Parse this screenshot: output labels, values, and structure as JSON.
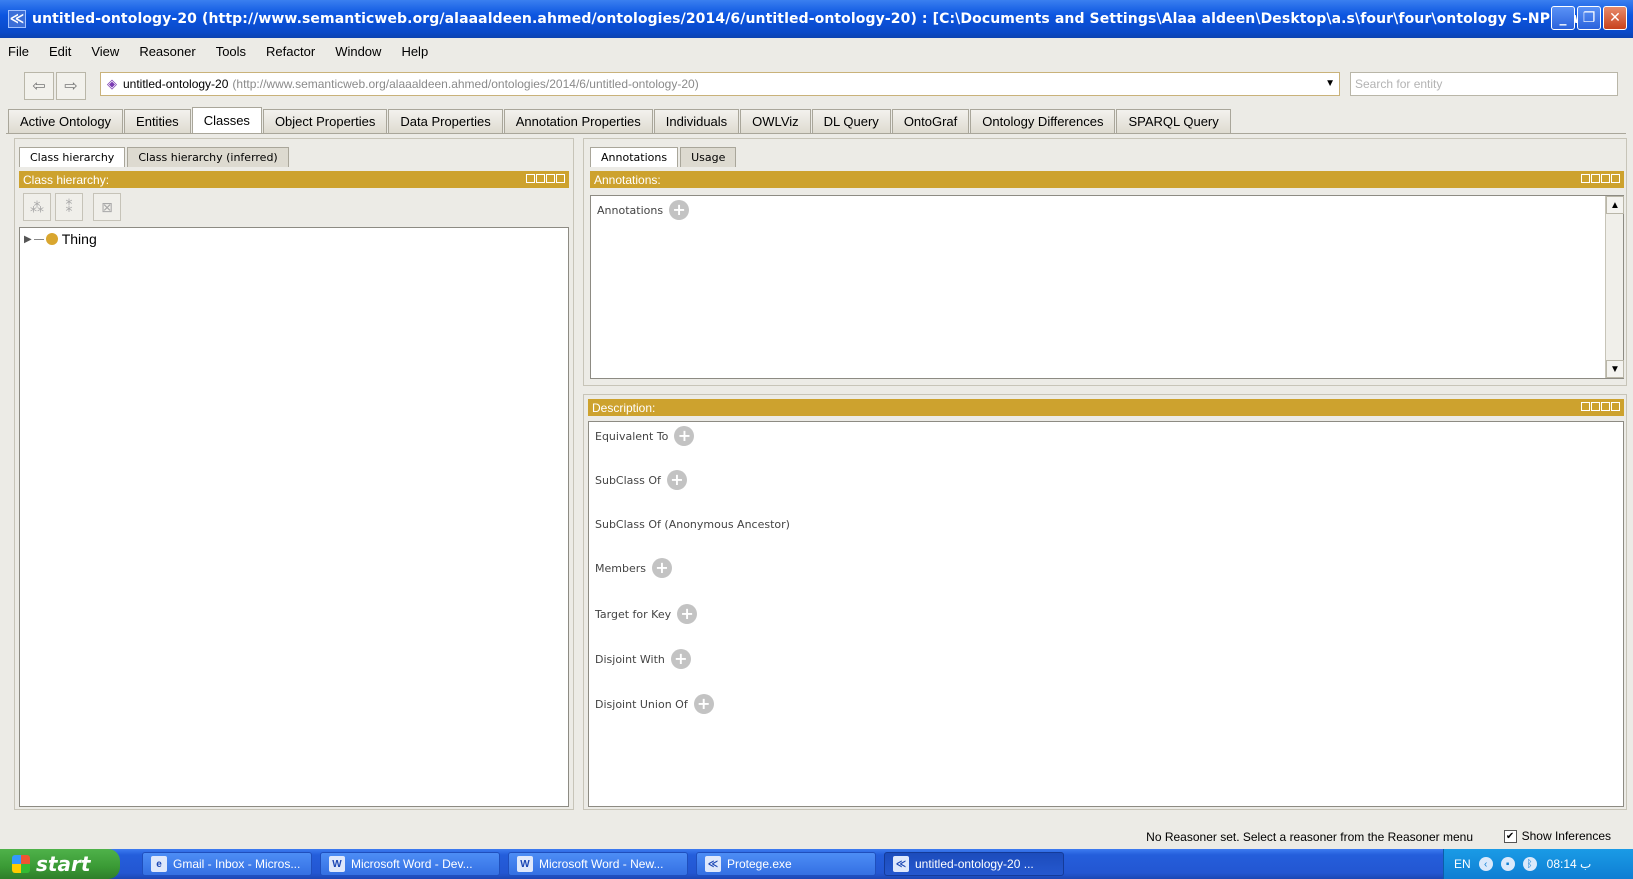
{
  "window": {
    "title": "untitled-ontology-20 (http://www.semanticweb.org/alaaaldeen.ahmed/ontologies/2014/6/untitled-ontology-20)  : [C:\\Documents and Settings\\Alaa aldeen\\Desktop\\a.s\\four\\four\\ontology S-NPF.owl]",
    "app_icon": "protege-icon"
  },
  "menu": [
    "File",
    "Edit",
    "View",
    "Reasoner",
    "Tools",
    "Refactor",
    "Window",
    "Help"
  ],
  "nav": {
    "back_icon": "⇦",
    "forward_icon": "⇨",
    "ontology_name": "untitled-ontology-20",
    "ontology_url": "(http://www.semanticweb.org/alaaaldeen.ahmed/ontologies/2014/6/untitled-ontology-20)",
    "search_placeholder": "Search for entity"
  },
  "main_tabs": [
    "Active Ontology",
    "Entities",
    "Classes",
    "Object Properties",
    "Data Properties",
    "Annotation Properties",
    "Individuals",
    "OWLViz",
    "DL Query",
    "OntoGraf",
    "Ontology Differences",
    "SPARQL Query"
  ],
  "active_main_tab": "Classes",
  "left": {
    "subtabs": [
      "Class hierarchy",
      "Class hierarchy (inferred)"
    ],
    "view_title": "Class hierarchy:",
    "tree_root": "Thing"
  },
  "right": {
    "subtabs": [
      "Annotations",
      "Usage"
    ],
    "annotations_title": "Annotations:",
    "annotations_label": "Annotations",
    "description_title": "Description:",
    "sections": [
      "Equivalent To",
      "SubClass Of",
      "SubClass Of (Anonymous Ancestor)",
      "Members",
      "Target for Key",
      "Disjoint With",
      "Disjoint Union Of"
    ]
  },
  "status": {
    "message": "No Reasoner set. Select a reasoner from the Reasoner menu",
    "show_inferences": "Show Inferences"
  },
  "taskbar": {
    "start": "start",
    "items": [
      {
        "label": "Gmail - Inbox - Micros...",
        "icon": "ie-icon"
      },
      {
        "label": "Microsoft Word - Dev...",
        "icon": "word-icon"
      },
      {
        "label": "Microsoft Word - New...",
        "icon": "word-icon"
      },
      {
        "label": "Protege.exe",
        "icon": "protege-icon"
      },
      {
        "label": "untitled-ontology-20 ...",
        "icon": "protege-icon"
      }
    ],
    "lang": "EN",
    "clock": "08:14 ب"
  }
}
